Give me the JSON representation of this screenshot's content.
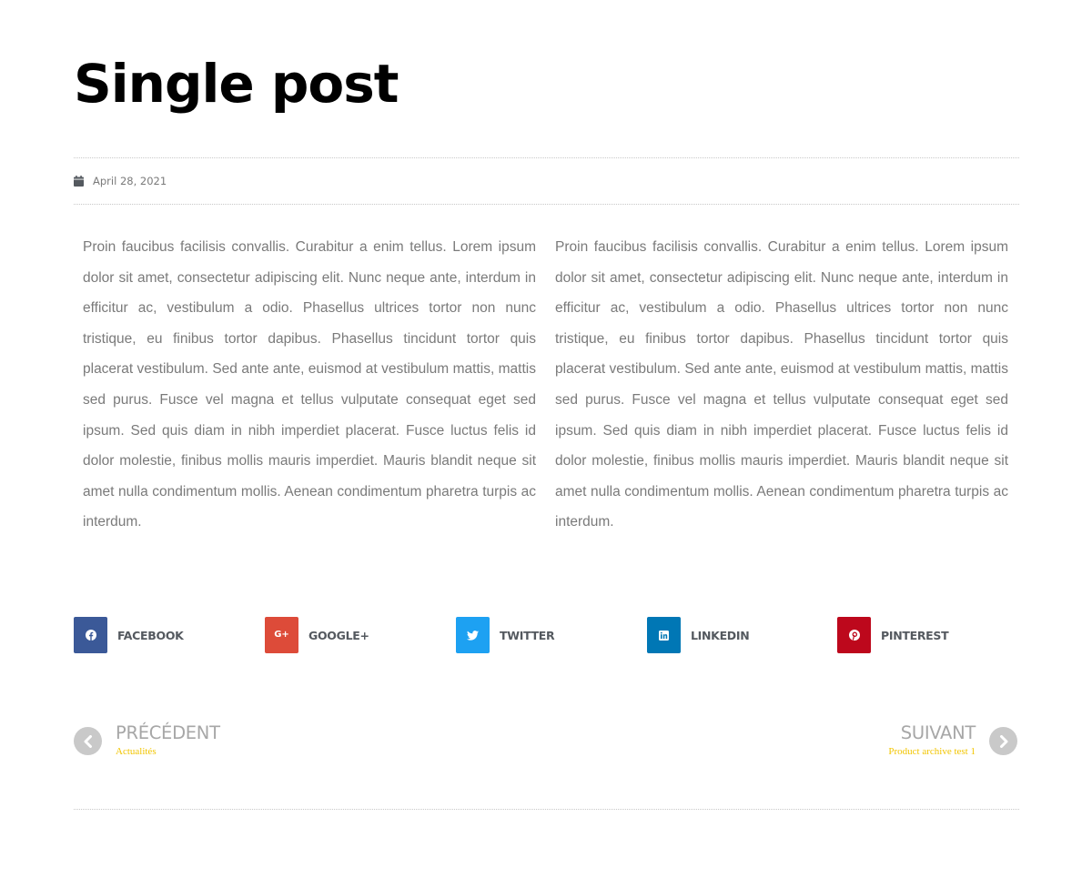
{
  "post": {
    "title": "Single post",
    "date": "April 28, 2021",
    "paragraphs": [
      "Proin faucibus facilisis convallis. Curabitur a enim tellus. Lorem ipsum dolor sit amet, consectetur adipiscing elit. Nunc neque ante, interdum in efficitur ac, vestibulum a odio. Phasellus ultrices tortor non nunc tristique, eu finibus tortor dapibus. Phasellus tincidunt tortor quis placerat vestibulum. Sed ante ante, euismod at vestibulum mattis, mattis sed purus. Fusce vel magna et tellus vulputate consequat eget sed ipsum. Sed quis diam in nibh imperdiet placerat. Fusce luctus felis id dolor molestie, finibus mollis mauris imperdiet. Mauris blandit neque sit amet nulla condimentum mollis. Aenean condimentum pharetra turpis ac interdum.",
      "Proin faucibus facilisis convallis. Curabitur a enim tellus. Lorem ipsum dolor sit amet, consectetur adipiscing elit. Nunc neque ante, interdum in efficitur ac, vestibulum a odio. Phasellus ultrices tortor non nunc tristique, eu finibus tortor dapibus. Phasellus tincidunt tortor quis placerat vestibulum. Sed ante ante, euismod at vestibulum mattis, mattis sed purus. Fusce vel magna et tellus vulputate consequat eget sed ipsum. Sed quis diam in nibh imperdiet placerat. Fusce luctus felis id dolor molestie, finibus mollis mauris imperdiet. Mauris blandit neque sit amet nulla condimentum mollis. Aenean condimentum pharetra turpis ac interdum."
    ]
  },
  "share": [
    {
      "label": "FACEBOOK",
      "icon": "facebook-icon",
      "color": "#3b5998"
    },
    {
      "label": "GOOGLE+",
      "icon": "google-plus-icon",
      "color": "#dd4b39"
    },
    {
      "label": "TWITTER",
      "icon": "twitter-icon",
      "color": "#1da1f2"
    },
    {
      "label": "LINKEDIN",
      "icon": "linkedin-icon",
      "color": "#0077b5"
    },
    {
      "label": "PINTEREST",
      "icon": "pinterest-icon",
      "color": "#bd081c"
    }
  ],
  "navigation": {
    "prev": {
      "label": "PRÉCÉDENT",
      "title": "Actualités",
      "icon": "chevron-left-icon"
    },
    "next": {
      "label": "SUIVANT",
      "title": "Product archive test 1",
      "icon": "chevron-right-icon"
    }
  },
  "colors": {
    "heading": "#000000",
    "text": "#7a7a7a",
    "accent": "#f2c500",
    "nav_arrow": "#c9c9c9"
  }
}
